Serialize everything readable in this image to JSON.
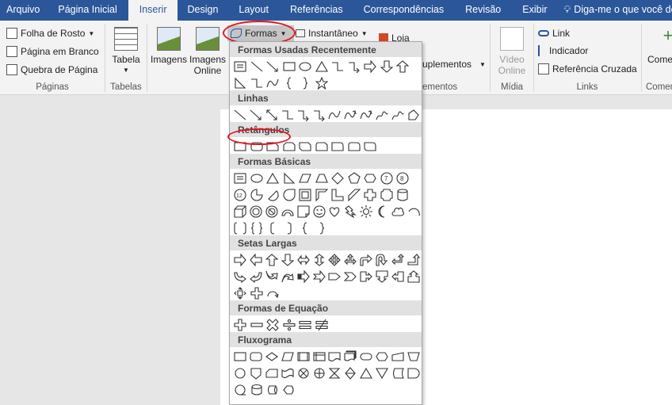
{
  "tabs": [
    {
      "label": "Arquivo"
    },
    {
      "label": "Página Inicial"
    },
    {
      "label": "Inserir"
    },
    {
      "label": "Design"
    },
    {
      "label": "Layout"
    },
    {
      "label": "Referências"
    },
    {
      "label": "Correspondências"
    },
    {
      "label": "Revisão"
    },
    {
      "label": "Exibir"
    }
  ],
  "active_tab": "Inserir",
  "tellme": {
    "text": "Diga-me o que você des"
  },
  "ribbon": {
    "paginas": {
      "folha_rosto": "Folha de Rosto",
      "pagina_branco": "Página em Branco",
      "quebra_pagina": "Quebra de Página",
      "label": "Páginas"
    },
    "tabelas": {
      "tabela": "Tabela",
      "label": "Tabelas"
    },
    "ilustracoes": {
      "imagens": "Imagens",
      "imagens_online_1": "Imagens",
      "imagens_online_2": "Online",
      "formas": "Formas",
      "instantaneo": "Instantâneo"
    },
    "suplementos": {
      "loja": "Loja",
      "suplementos": "uplementos",
      "label": "ementos"
    },
    "midia": {
      "video_1": "Vídeo",
      "video_2": "Online",
      "label": "Mídia"
    },
    "links": {
      "link": "Link",
      "indicador": "Indicador",
      "referencia_cruzada": "Referência Cruzada",
      "label": "Links"
    },
    "comentarios": {
      "comentario": "Come",
      "label": "Comen"
    }
  },
  "dropdown": {
    "sections": [
      {
        "title": "Formas Usadas Recentemente"
      },
      {
        "title": "Linhas"
      },
      {
        "title": "Retângulos"
      },
      {
        "title": "Formas Básicas"
      },
      {
        "title": "Setas Largas"
      },
      {
        "title": "Formas de Equação"
      },
      {
        "title": "Fluxograma"
      }
    ]
  },
  "highlight_color": "#e3161e",
  "accent_color": "#2b579a"
}
